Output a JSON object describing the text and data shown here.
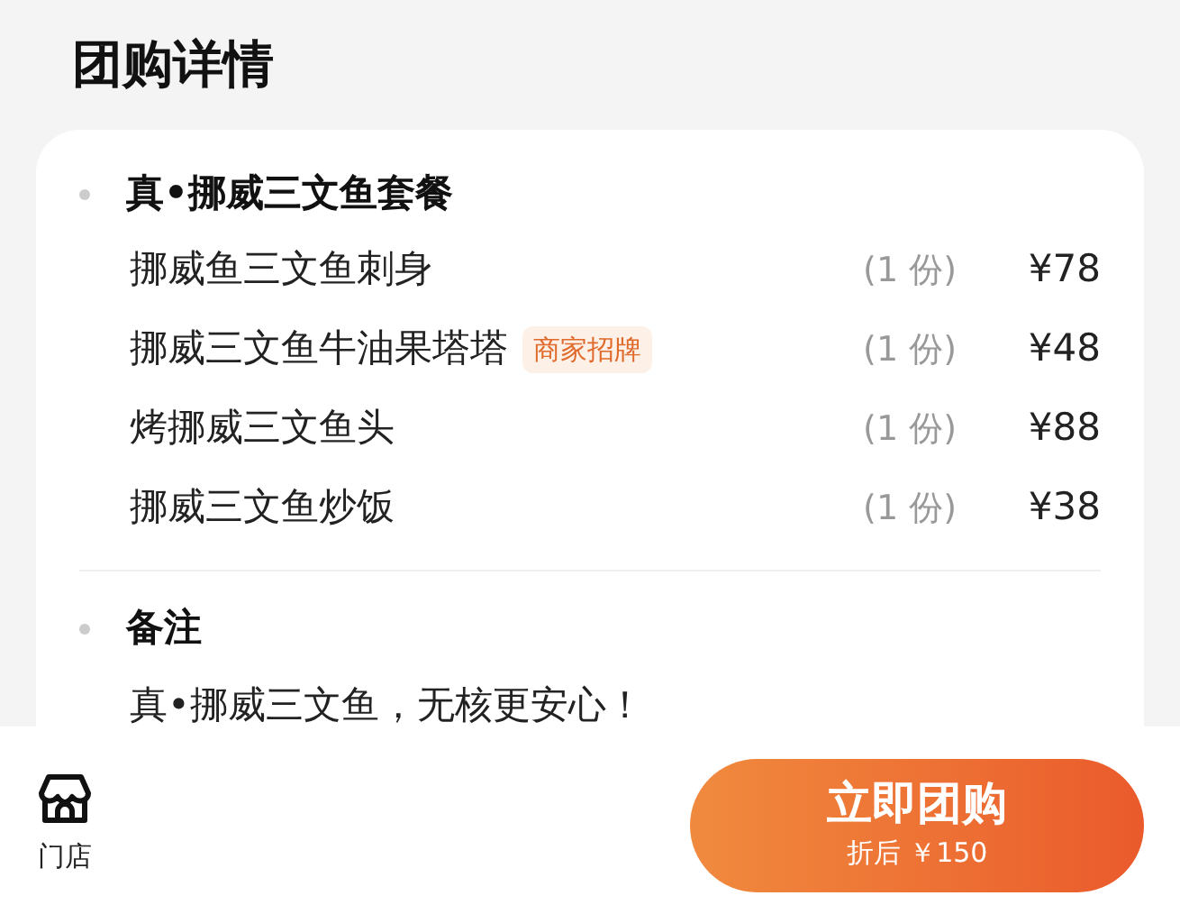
{
  "title": "团购详情",
  "sections": [
    {
      "title": "真•挪威三文鱼套餐",
      "kind": "items",
      "items": [
        {
          "name": "挪威鱼三文鱼刺身",
          "qty": "(1 份)",
          "price": "¥78"
        },
        {
          "name": "挪威三文鱼牛油果塔塔",
          "tag": "商家招牌",
          "qty": "(1 份)",
          "price": "¥48"
        },
        {
          "name": "烤挪威三文鱼头",
          "qty": "(1 份)",
          "price": "¥88"
        },
        {
          "name": "挪威三文鱼炒饭",
          "qty": "(1 份)",
          "price": "¥38"
        }
      ]
    },
    {
      "title": "备注",
      "kind": "note",
      "text": "真•挪威三文鱼，无核更安心！"
    }
  ],
  "bottom_bar": {
    "store_label": "门店",
    "buy_button": {
      "label": "立即团购",
      "sub_label": "折后 ￥150"
    }
  }
}
